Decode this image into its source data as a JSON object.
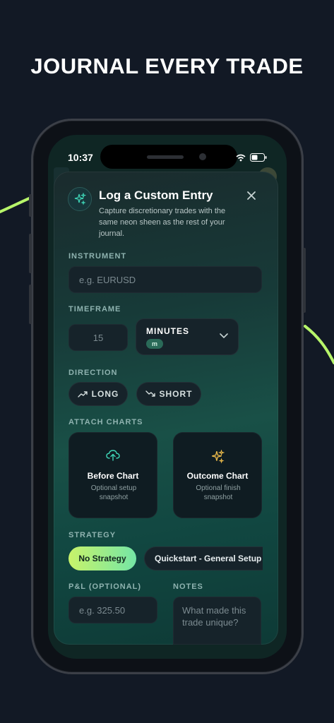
{
  "headline": "JOURNAL EVERY TRADE",
  "status": {
    "time": "10:37"
  },
  "card": {
    "title": "Log a Custom Entry",
    "subtitle": "Capture discretionary trades with the same neon sheen as the rest of your journal."
  },
  "instrument": {
    "label": "INSTRUMENT",
    "placeholder": "e.g. EURUSD"
  },
  "timeframe": {
    "label": "TIMEFRAME",
    "value": "15",
    "unit": "MINUTES",
    "unit_badge": "m"
  },
  "direction": {
    "label": "DIRECTION",
    "options": [
      "LONG",
      "SHORT"
    ]
  },
  "charts": {
    "label": "ATTACH CHARTS",
    "before": {
      "title": "Before Chart",
      "sub": "Optional setup snapshot"
    },
    "outcome": {
      "title": "Outcome Chart",
      "sub": "Optional finish snapshot"
    }
  },
  "strategy": {
    "label": "STRATEGY",
    "options": [
      "No Strategy",
      "Quickstart - General Setup"
    ],
    "selected": "No Strategy"
  },
  "pnl": {
    "label": "P&L (OPTIONAL)",
    "placeholder": "e.g. 325.50"
  },
  "notes": {
    "label": "NOTES",
    "placeholder": "What made this trade unique?"
  },
  "colors": {
    "background": "#121925",
    "accent_start": "#c8f36a",
    "accent_end": "#74e6a6",
    "teal_icon": "#3fd7b8",
    "gold_icon": "#e8b84a"
  },
  "icons": [
    "sparkles-icon",
    "close-icon",
    "chevron-down-icon",
    "trend-up-icon",
    "trend-down-icon",
    "cloud-upload-icon",
    "sparkles-gold-icon",
    "wifi-icon",
    "battery-icon"
  ]
}
